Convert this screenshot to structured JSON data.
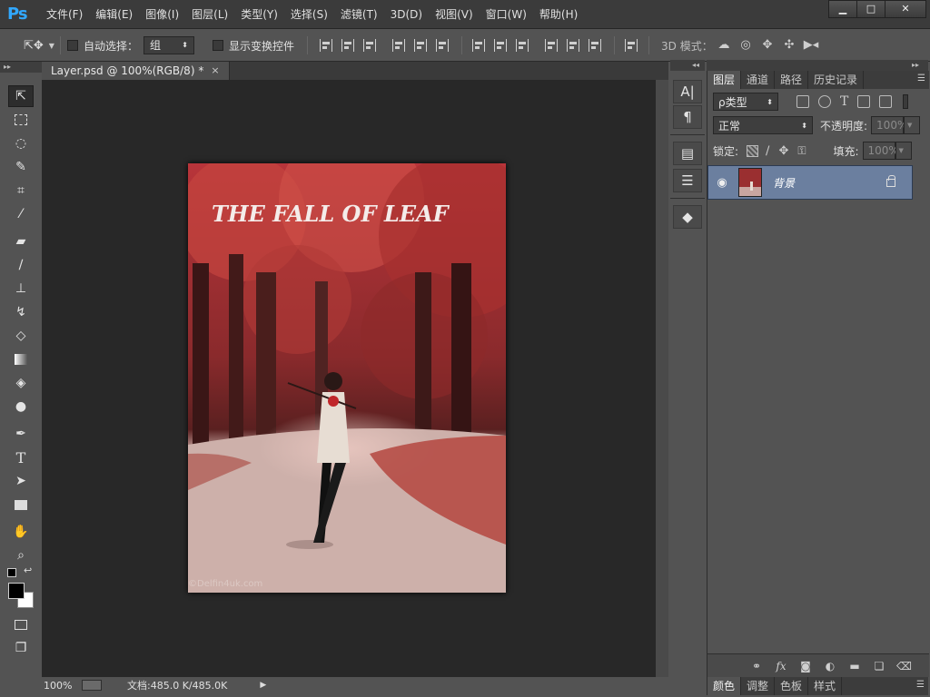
{
  "app": {
    "logo": "Ps"
  },
  "menu": [
    "文件(F)",
    "编辑(E)",
    "图像(I)",
    "图层(L)",
    "类型(Y)",
    "选择(S)",
    "滤镜(T)",
    "3D(D)",
    "视图(V)",
    "窗口(W)",
    "帮助(H)"
  ],
  "window": {
    "minimize": "▁",
    "maximize": "□",
    "close": "✕"
  },
  "options": {
    "auto_select_label": "自动选择：",
    "auto_select_value": "组",
    "show_transform_label": "显示变换控件",
    "mode_3d_label": "3D 模式："
  },
  "document": {
    "tab_title": "Layer.psd @ 100%(RGB/8) *",
    "tab_close": "×",
    "image_title": "THE FALL OF LEAF",
    "watermark": "©Delfin4uk.com"
  },
  "status": {
    "zoom": "100%",
    "doc_size": "文档:485.0 K/485.0K",
    "arrow": "▶"
  },
  "panel": {
    "tabs": [
      "图层",
      "通道",
      "路径",
      "历史记录"
    ],
    "filter_type": "ρ类型",
    "blend_mode": "正常",
    "opacity_label": "不透明度:",
    "opacity_value": "100%",
    "lock_label": "锁定:",
    "fill_label": "填充:",
    "fill_value": "100%",
    "layer_name": "背景",
    "footer_icons": [
      "link-icon",
      "fx-icon",
      "mask-icon",
      "adjustment-icon",
      "folder-icon",
      "new-layer-icon",
      "trash-icon"
    ],
    "fx_label": "fx"
  },
  "bottom_tabs": [
    "颜色",
    "调整",
    "色板",
    "样式"
  ],
  "colors": {
    "accent": "#31a8ff",
    "layer_selected": "#6b7f9f",
    "canvas_bg": "#282828",
    "panel_bg": "#535353"
  }
}
